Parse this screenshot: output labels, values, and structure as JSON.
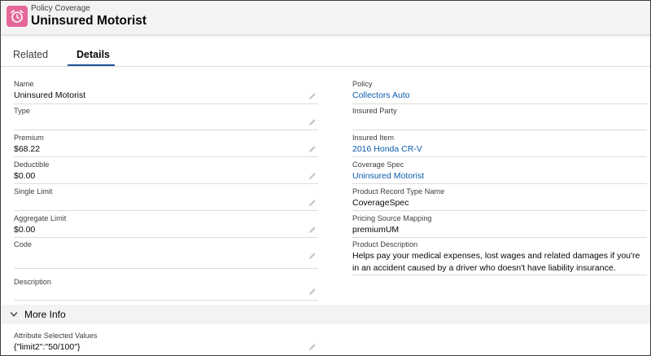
{
  "header": {
    "object_type": "Policy Coverage",
    "title": "Uninsured Motorist",
    "icon": "alarm-clock-icon",
    "icon_color": "#e56798"
  },
  "tabs": [
    {
      "label": "Related",
      "active": false
    },
    {
      "label": "Details",
      "active": true
    }
  ],
  "left_fields": [
    {
      "label": "Name",
      "value": "Uninsured Motorist"
    },
    {
      "label": "Type",
      "value": ""
    },
    {
      "label": "Premium",
      "value": "$68.22"
    },
    {
      "label": "Deductible",
      "value": "$0.00"
    },
    {
      "label": "Single Limit",
      "value": ""
    },
    {
      "label": "Aggregate Limit",
      "value": "$0.00"
    },
    {
      "label": "Code",
      "value": ""
    },
    {
      "label": "Description",
      "value": ""
    }
  ],
  "right_fields": [
    {
      "label": "Policy",
      "value": "Collectors Auto",
      "link": true
    },
    {
      "label": "Insured Party",
      "value": ""
    },
    {
      "label": "Insured Item",
      "value": "2016 Honda CR-V",
      "link": true
    },
    {
      "label": "Coverage Spec",
      "value": "Uninsured Motorist",
      "link": true
    },
    {
      "label": "Product Record Type Name",
      "value": "CoverageSpec"
    },
    {
      "label": "Pricing Source Mapping",
      "value": "premiumUM"
    },
    {
      "label": "Product Description",
      "value": "Helps pay your medical expenses, lost wages and related damages if you're in an accident caused by a driver who doesn't have liability insurance."
    }
  ],
  "more_info": {
    "title": "More Info",
    "fields": [
      {
        "label": "Attribute Selected Values",
        "value": "{\"limit2\":\"50/100\"}"
      }
    ]
  },
  "colors": {
    "link": "#0b5cab",
    "tab_underline": "#1b5297",
    "header_bg": "#f3f3f3"
  }
}
